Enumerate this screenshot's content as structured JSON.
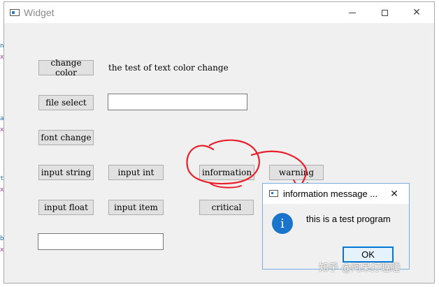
{
  "window": {
    "title": "Widget",
    "minimize_glyph": "",
    "close_glyph": "✕"
  },
  "buttons": {
    "change_color": "change color",
    "file_select": "file select",
    "font_change": "font change",
    "input_string": "input string",
    "input_int": "input int",
    "information": "information",
    "warning": "warning",
    "input_float": "input float",
    "input_item": "input item",
    "critical": "critical"
  },
  "labels": {
    "color_test": "the test of text color change"
  },
  "inputs": {
    "file_path_value": "",
    "bottom_value": ""
  },
  "dialog": {
    "title": "information message ...",
    "message": "this is a test program",
    "icon_glyph": "i",
    "ok_label": "OK",
    "close_glyph": "✕"
  },
  "watermark": "知乎 @阿呆打瞌睡",
  "edge_chars": [
    "n",
    "x",
    "a",
    "x",
    "t",
    "x",
    "b",
    "x"
  ],
  "colors": {
    "annotation_red": "#e8202a",
    "dialog_accent": "#0078d7",
    "info_icon": "#1a74cc"
  }
}
